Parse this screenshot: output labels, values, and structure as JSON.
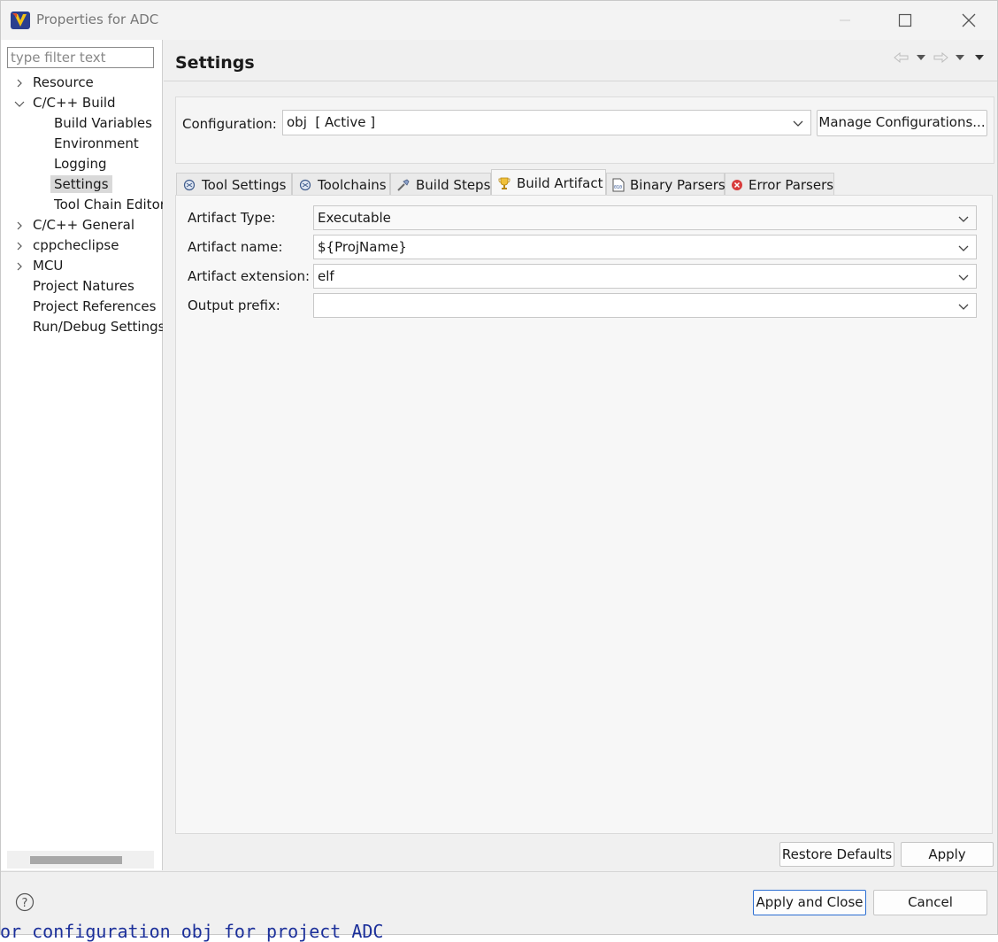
{
  "window": {
    "title": "Properties for ADC"
  },
  "left": {
    "filter_placeholder": "type filter text",
    "tree": [
      {
        "label": "Resource",
        "expander": "right"
      },
      {
        "label": "C/C++ Build",
        "expander": "down"
      },
      {
        "label": "Build Variables",
        "expander": "none"
      },
      {
        "label": "Environment",
        "expander": "none"
      },
      {
        "label": "Logging",
        "expander": "none"
      },
      {
        "label": "Settings",
        "expander": "none",
        "selected": true
      },
      {
        "label": "Tool Chain Editor",
        "expander": "none"
      },
      {
        "label": "C/C++ General",
        "expander": "right"
      },
      {
        "label": "cppcheclipse",
        "expander": "right"
      },
      {
        "label": "MCU",
        "expander": "right"
      },
      {
        "label": "Project Natures",
        "expander": "none"
      },
      {
        "label": "Project References",
        "expander": "none"
      },
      {
        "label": "Run/Debug Settings",
        "expander": "none"
      }
    ]
  },
  "main": {
    "title": "Settings",
    "configuration": {
      "label": "Configuration:",
      "value": "obj  [ Active ]",
      "manage_label": "Manage Configurations..."
    },
    "tabs": [
      {
        "label": "Tool Settings",
        "icon": "tool-settings-icon"
      },
      {
        "label": "Toolchains",
        "icon": "toolchains-icon"
      },
      {
        "label": "Build Steps",
        "icon": "build-steps-icon"
      },
      {
        "label": "Build Artifact",
        "icon": "trophy-icon",
        "active": true
      },
      {
        "label": "Binary Parsers",
        "icon": "binary-parsers-icon"
      },
      {
        "label": "Error Parsers",
        "icon": "error-icon"
      }
    ],
    "fields": {
      "artifact_type": {
        "label": "Artifact Type:",
        "value": "Executable"
      },
      "artifact_name": {
        "label": "Artifact name:",
        "value": "${ProjName}"
      },
      "artifact_extension": {
        "label": "Artifact extension:",
        "value": "elf"
      },
      "output_prefix": {
        "label": "Output prefix:",
        "value": ""
      }
    },
    "restore_defaults_label": "Restore Defaults",
    "apply_label": "Apply"
  },
  "footer": {
    "apply_close_label": "Apply and Close",
    "cancel_label": "Cancel"
  },
  "status_text": "or configuration obj for project ADC",
  "colors": {
    "accent": "#2b6ed2",
    "status_text": "#1b2f9a",
    "error_icon": "#d83b3b",
    "trophy": "#e0a526"
  }
}
